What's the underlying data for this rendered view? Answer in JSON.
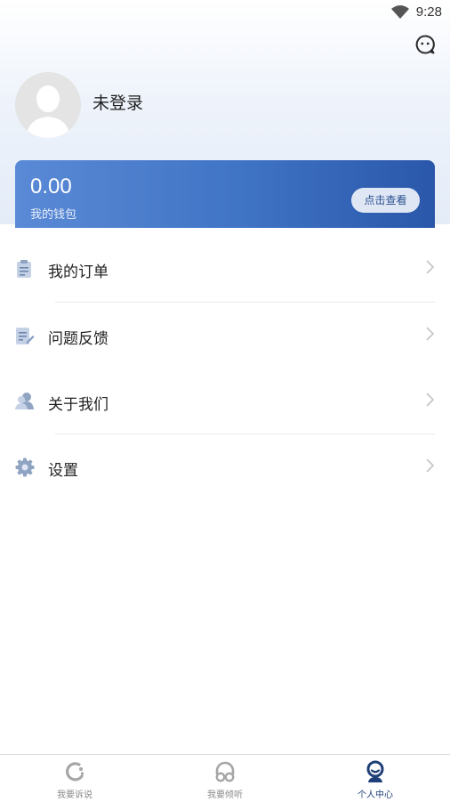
{
  "status_bar": {
    "time": "9:28"
  },
  "profile": {
    "login_status": "未登录"
  },
  "wallet": {
    "amount": "0.00",
    "label": "我的钱包",
    "button_label": "点击查看"
  },
  "menu": {
    "items": [
      {
        "label": "我的订单",
        "icon": "clipboard-icon"
      },
      {
        "label": "问题反馈",
        "icon": "feedback-edit-icon"
      },
      {
        "label": "关于我们",
        "icon": "people-icon"
      },
      {
        "label": "设置",
        "icon": "gear-icon"
      }
    ]
  },
  "tabbar": {
    "tabs": [
      {
        "label": "我要诉说",
        "icon": "speak-icon"
      },
      {
        "label": "我要倾听",
        "icon": "listen-icon"
      },
      {
        "label": "个人中心",
        "icon": "profile-icon",
        "active": true
      }
    ]
  },
  "colors": {
    "wallet_gradient_start": "#5a8ad6",
    "wallet_gradient_end": "#2a57a9",
    "active_tab": "#1e3f77",
    "inactive_tab": "#8a8a8a"
  }
}
